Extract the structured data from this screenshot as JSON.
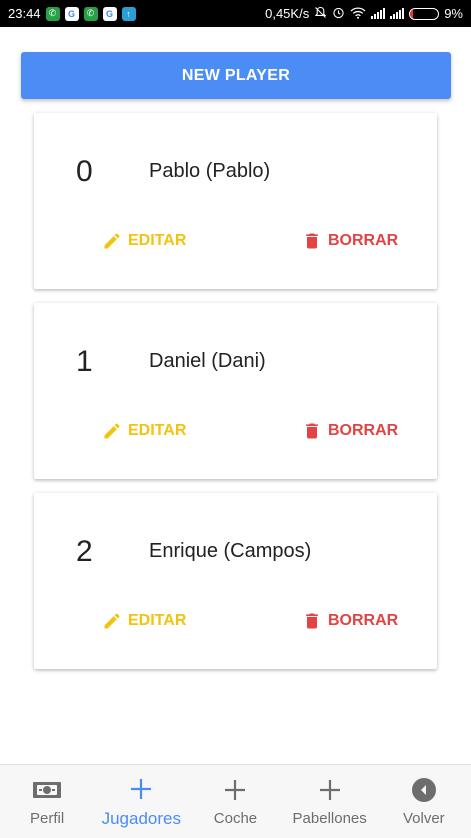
{
  "status_bar": {
    "time": "23:44",
    "network_speed": "0,45K/s",
    "battery_percent": "9%",
    "battery_level": 0.09,
    "notification_icons": [
      "whatsapp-icon",
      "google-icon",
      "whatsapp-icon",
      "google-icon",
      "upload-icon"
    ],
    "system_icons": [
      "notifications-off-icon",
      "alarm-icon",
      "wifi-icon",
      "signal-icon",
      "signal-icon",
      "battery-icon"
    ]
  },
  "toolbar": {
    "new_player_label": "NEW PLAYER"
  },
  "players": [
    {
      "number": "0",
      "name": "Pablo (Pablo)",
      "edit_label": "EDITAR",
      "delete_label": "BORRAR"
    },
    {
      "number": "1",
      "name": "Daniel (Dani)",
      "edit_label": "EDITAR",
      "delete_label": "BORRAR"
    },
    {
      "number": "2",
      "name": "Enrique (Campos)",
      "edit_label": "EDITAR",
      "delete_label": "BORRAR"
    }
  ],
  "bottom_nav": {
    "items": [
      {
        "label": "Perfil",
        "icon": "money-icon",
        "active": false
      },
      {
        "label": "Jugadores",
        "icon": "plus-icon",
        "active": true
      },
      {
        "label": "Coche",
        "icon": "plus-icon",
        "active": false
      },
      {
        "label": "Pabellones",
        "icon": "plus-icon",
        "active": false
      },
      {
        "label": "Volver",
        "icon": "back-circle-icon",
        "active": false
      }
    ]
  },
  "colors": {
    "primary": "#4b8df5",
    "edit": "#f2c30f",
    "delete": "#e24444",
    "nav_active": "#4a8cf4",
    "nav_inactive": "#6d6d6d"
  }
}
